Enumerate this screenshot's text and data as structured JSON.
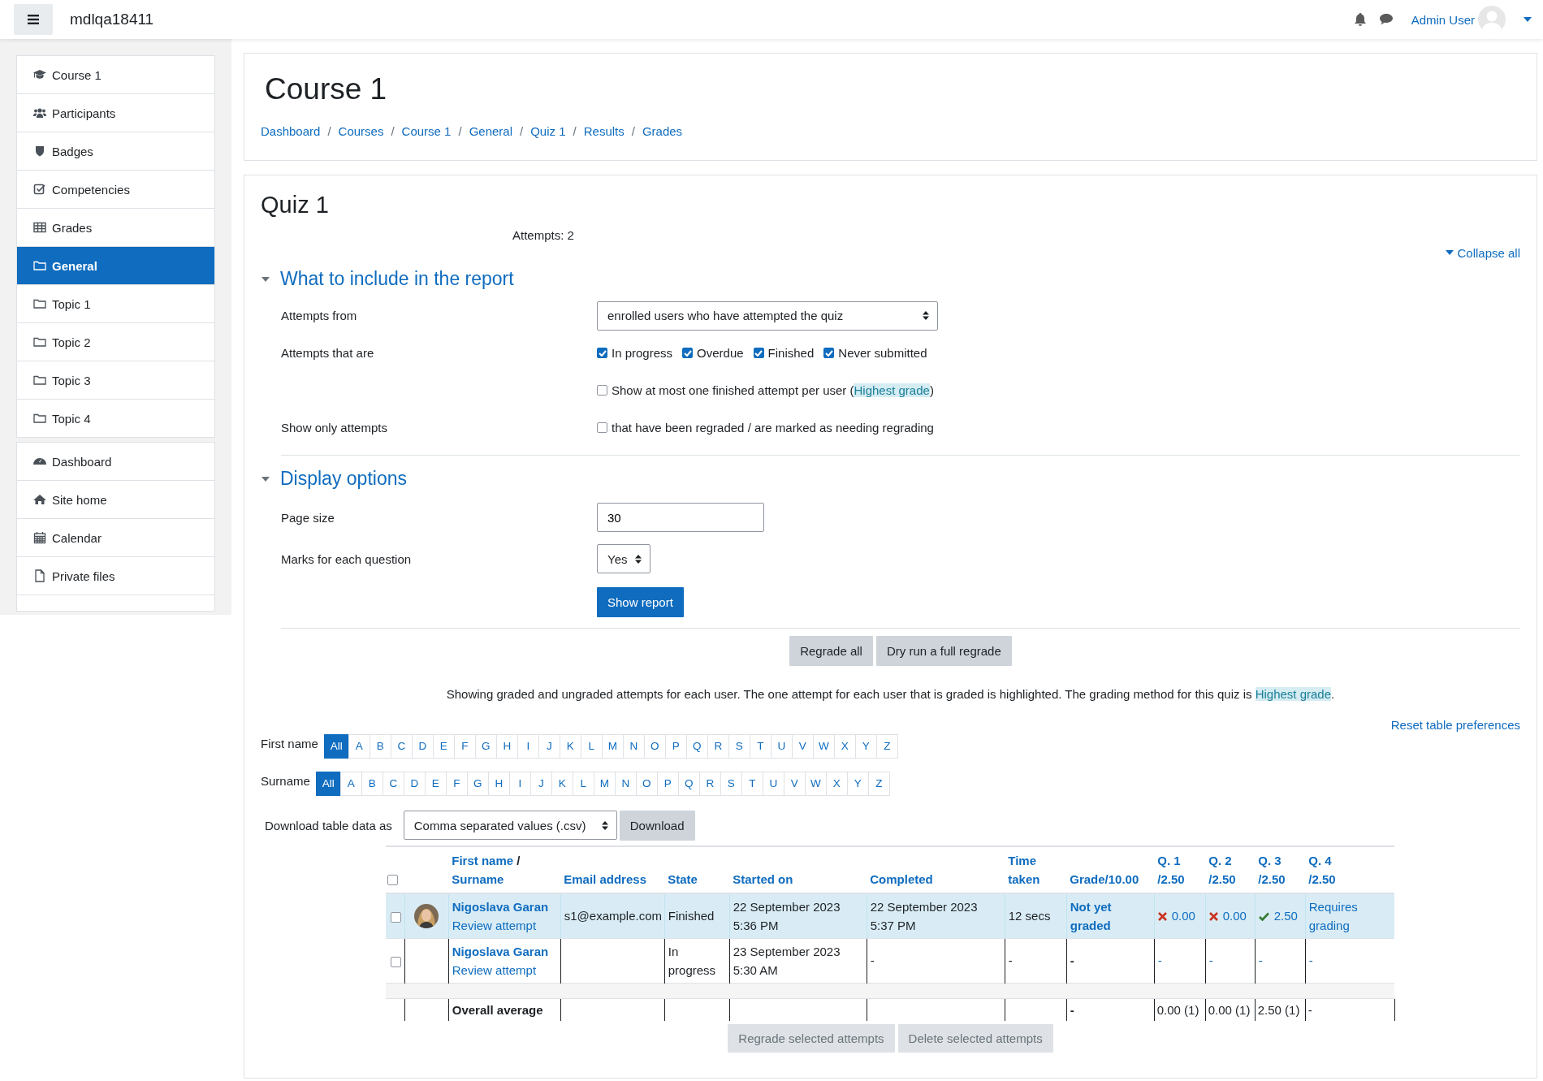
{
  "navbar": {
    "site_name": "mdlqa18411",
    "user_name": "Admin User"
  },
  "sidebar": {
    "groups": [
      {
        "items": [
          {
            "kind": "course",
            "label": "Course 1",
            "selected": false
          },
          {
            "kind": "participants",
            "label": "Participants",
            "selected": false
          },
          {
            "kind": "badges",
            "label": "Badges",
            "selected": false
          },
          {
            "kind": "competencies",
            "label": "Competencies",
            "selected": false
          },
          {
            "kind": "grades",
            "label": "Grades",
            "selected": false
          },
          {
            "kind": "section",
            "label": "General",
            "selected": true
          },
          {
            "kind": "section",
            "label": "Topic 1",
            "selected": false
          },
          {
            "kind": "section",
            "label": "Topic 2",
            "selected": false
          },
          {
            "kind": "section",
            "label": "Topic 3",
            "selected": false
          },
          {
            "kind": "section",
            "label": "Topic 4",
            "selected": false
          }
        ]
      },
      {
        "items": [
          {
            "kind": "dashboard",
            "label": "Dashboard",
            "selected": false
          },
          {
            "kind": "site_home",
            "label": "Site home",
            "selected": false
          },
          {
            "kind": "calendar",
            "label": "Calendar",
            "selected": false
          },
          {
            "kind": "private_files",
            "label": "Private files",
            "selected": false
          }
        ]
      }
    ]
  },
  "header": {
    "title": "Course 1",
    "separator": "/",
    "breadcrumbs": [
      "Dashboard",
      "Courses",
      "Course 1",
      "General",
      "Quiz 1",
      "Results",
      "Grades"
    ]
  },
  "quiz": {
    "title": "Quiz 1",
    "attempts_summary": "Attempts: 2",
    "collapse_link": "Collapse all"
  },
  "sections": [
    {
      "title": "What to include in the report",
      "expanded": true,
      "rows": [
        {
          "kind": "select",
          "label": "Attempts from",
          "value": "enrolled users who have attempted the quiz"
        },
        {
          "kind": "checkboxes",
          "label": "Attempts that are",
          "options": [
            {
              "label": "In progress",
              "checked": true
            },
            {
              "label": "Overdue",
              "checked": true
            },
            {
              "label": "Finished",
              "checked": true
            },
            {
              "label": "Never submitted",
              "checked": true
            }
          ]
        },
        {
          "kind": "checkbox_link",
          "checked": false,
          "text_before": "Show at most one finished attempt per user (",
          "link": "Highest grade",
          "text_after": ")"
        },
        {
          "kind": "checkbox_text",
          "label": "Show only attempts",
          "checked": false,
          "text": "that have been regraded / are marked as needing regrading"
        }
      ]
    },
    {
      "title": "Display options",
      "expanded": true,
      "rows": [
        {
          "kind": "text",
          "label": "Page size",
          "value": "30"
        },
        {
          "kind": "small_select",
          "label": "Marks for each question",
          "value": "Yes"
        },
        {
          "kind": "submit",
          "label": "Show report"
        }
      ]
    }
  ],
  "regrade_buttons": [
    "Regrade all",
    "Dry run a full regrade"
  ],
  "grading_note": {
    "text_before": "Showing graded and ungraded attempts for each user. The one attempt for each user that is graded is highlighted. The grading method for this quiz is ",
    "link": "Highest grade",
    "text_after": "."
  },
  "reset_link": "Reset table preferences",
  "initials_bars": [
    {
      "label": "First name",
      "letters": [
        {
          "label": "All",
          "selected": true
        },
        {
          "label": "A",
          "selected": false
        },
        {
          "label": "B",
          "selected": false
        },
        {
          "label": "C",
          "selected": false
        },
        {
          "label": "D",
          "selected": false
        },
        {
          "label": "E",
          "selected": false
        },
        {
          "label": "F",
          "selected": false
        },
        {
          "label": "G",
          "selected": false
        },
        {
          "label": "H",
          "selected": false
        },
        {
          "label": "I",
          "selected": false
        },
        {
          "label": "J",
          "selected": false
        },
        {
          "label": "K",
          "selected": false
        },
        {
          "label": "L",
          "selected": false
        },
        {
          "label": "M",
          "selected": false
        },
        {
          "label": "N",
          "selected": false
        },
        {
          "label": "O",
          "selected": false
        },
        {
          "label": "P",
          "selected": false
        },
        {
          "label": "Q",
          "selected": false
        },
        {
          "label": "R",
          "selected": false
        },
        {
          "label": "S",
          "selected": false
        },
        {
          "label": "T",
          "selected": false
        },
        {
          "label": "U",
          "selected": false
        },
        {
          "label": "V",
          "selected": false
        },
        {
          "label": "W",
          "selected": false
        },
        {
          "label": "X",
          "selected": false
        },
        {
          "label": "Y",
          "selected": false
        },
        {
          "label": "Z",
          "selected": false
        }
      ]
    },
    {
      "label": "Surname",
      "letters": [
        {
          "label": "All",
          "selected": true
        },
        {
          "label": "A",
          "selected": false
        },
        {
          "label": "B",
          "selected": false
        },
        {
          "label": "C",
          "selected": false
        },
        {
          "label": "D",
          "selected": false
        },
        {
          "label": "E",
          "selected": false
        },
        {
          "label": "F",
          "selected": false
        },
        {
          "label": "G",
          "selected": false
        },
        {
          "label": "H",
          "selected": false
        },
        {
          "label": "I",
          "selected": false
        },
        {
          "label": "J",
          "selected": false
        },
        {
          "label": "K",
          "selected": false
        },
        {
          "label": "L",
          "selected": false
        },
        {
          "label": "M",
          "selected": false
        },
        {
          "label": "N",
          "selected": false
        },
        {
          "label": "O",
          "selected": false
        },
        {
          "label": "P",
          "selected": false
        },
        {
          "label": "Q",
          "selected": false
        },
        {
          "label": "R",
          "selected": false
        },
        {
          "label": "S",
          "selected": false
        },
        {
          "label": "T",
          "selected": false
        },
        {
          "label": "U",
          "selected": false
        },
        {
          "label": "V",
          "selected": false
        },
        {
          "label": "W",
          "selected": false
        },
        {
          "label": "X",
          "selected": false
        },
        {
          "label": "Y",
          "selected": false
        },
        {
          "label": "Z",
          "selected": false
        }
      ]
    }
  ],
  "download": {
    "label": "Download table data as",
    "format": "Comma separated values (.csv)",
    "button": "Download"
  },
  "table": {
    "select_all": {
      "checked": false
    },
    "columns": [
      {
        "kind": "name",
        "sort_links": [
          "First name",
          "Surname"
        ],
        "separator": "/"
      },
      {
        "kind": "sort",
        "label": "Email address"
      },
      {
        "kind": "sort",
        "label": "State"
      },
      {
        "kind": "sort",
        "label": "Started on"
      },
      {
        "kind": "sort",
        "label": "Completed"
      },
      {
        "kind": "sort",
        "label": "Time taken"
      },
      {
        "kind": "sort",
        "label": "Grade/10.00"
      },
      {
        "kind": "sort",
        "label": "Q. 1",
        "label_2": "/2.50"
      },
      {
        "kind": "sort",
        "label": "Q. 2",
        "label_2": "/2.50"
      },
      {
        "kind": "sort",
        "label": "Q. 3",
        "label_2": "/2.50"
      },
      {
        "kind": "sort",
        "label": "Q. 4",
        "label_2": "/2.50"
      }
    ],
    "rows": [
      {
        "highlighted": true,
        "checked": false,
        "avatar": true,
        "name": "Nigoslava Garan",
        "review_link": "Review attempt",
        "email": "s1@example.com",
        "state": "Finished",
        "started": "22 September 2023 5:36 PM",
        "completed": "22 September 2023 5:37 PM",
        "time_taken": "12 secs",
        "grade": {
          "text": "Not yet graded",
          "link": true
        },
        "questions": [
          {
            "value": "0.00",
            "kind": "incorrect"
          },
          {
            "value": "0.00",
            "kind": "incorrect"
          },
          {
            "value": "2.50",
            "kind": "correct"
          },
          {
            "value": "Requires grading",
            "kind": "plain"
          }
        ]
      },
      {
        "highlighted": false,
        "checked": false,
        "avatar": false,
        "name": "Nigoslava Garan",
        "review_link": "Review attempt",
        "state": "In progress",
        "started": "23 September 2023 5:30 AM",
        "completed": "-",
        "time_taken": "-",
        "grade": {
          "text": "-",
          "link": false
        },
        "questions": [
          {
            "value": "-",
            "kind": "plain"
          },
          {
            "value": "-",
            "kind": "plain"
          },
          {
            "value": "-",
            "kind": "plain"
          },
          {
            "value": "-",
            "kind": "plain"
          }
        ]
      }
    ],
    "average": {
      "label": "Overall average",
      "grade": "-",
      "questions": [
        "0.00 (1)",
        "0.00 (1)",
        "2.50 (1)",
        "-"
      ]
    }
  },
  "bulk_buttons": [
    {
      "label": "Regrade selected attempts",
      "disabled": true
    },
    {
      "label": "Delete selected attempts",
      "disabled": true
    }
  ]
}
